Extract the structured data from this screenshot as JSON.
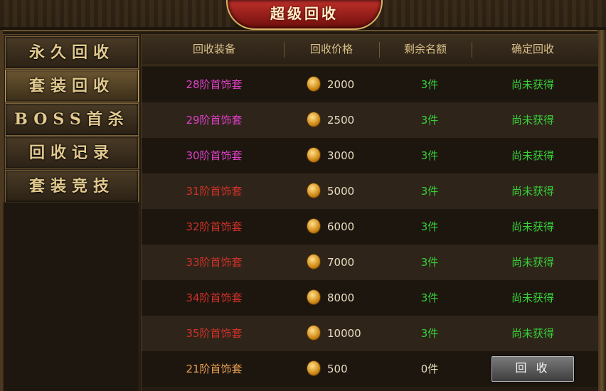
{
  "title": "超级回收",
  "menu": [
    {
      "label": "永久回收",
      "active": false
    },
    {
      "label": "套装回收",
      "active": true
    },
    {
      "label": "BOSS首杀",
      "active": false
    },
    {
      "label": "回收记录",
      "active": false
    },
    {
      "label": "套装竞技",
      "active": false
    }
  ],
  "columns": [
    "回收装备",
    "回收价格",
    "剩余名额",
    "确定回收"
  ],
  "rows": [
    {
      "name": "28阶首饰套",
      "price": "2000",
      "left": "3件",
      "state": "尚未获得"
    },
    {
      "name": "29阶首饰套",
      "price": "2500",
      "left": "3件",
      "state": "尚未获得"
    },
    {
      "name": "30阶首饰套",
      "price": "3000",
      "left": "3件",
      "state": "尚未获得"
    },
    {
      "name": "31阶首饰套",
      "price": "5000",
      "left": "3件",
      "state": "尚未获得"
    },
    {
      "name": "32阶首饰套",
      "price": "6000",
      "left": "3件",
      "state": "尚未获得"
    },
    {
      "name": "33阶首饰套",
      "price": "7000",
      "left": "3件",
      "state": "尚未获得"
    },
    {
      "name": "34阶首饰套",
      "price": "8000",
      "left": "3件",
      "state": "尚未获得"
    },
    {
      "name": "35阶首饰套",
      "price": "10000",
      "left": "3件",
      "state": "尚未获得"
    },
    {
      "name": "21阶首饰套",
      "price": "500",
      "left": "0件",
      "button": "回 收"
    }
  ],
  "colors": {
    "pink": "#e040c8",
    "red": "#d03228",
    "orange": "#e8a050",
    "green": "#38d038"
  }
}
